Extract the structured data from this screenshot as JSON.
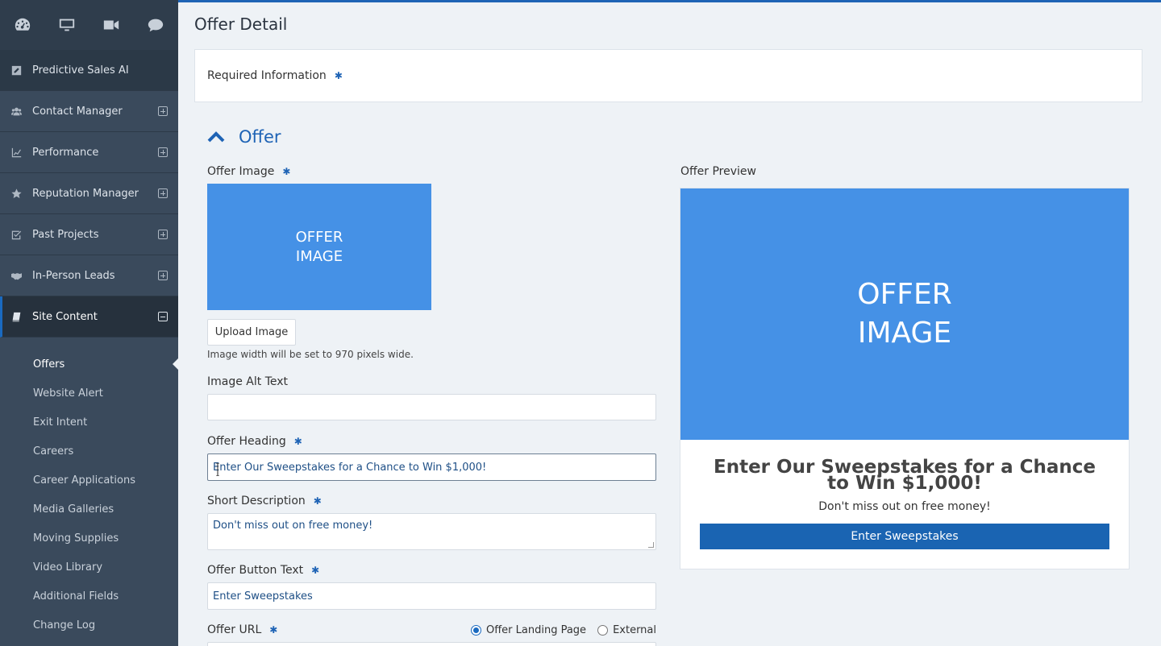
{
  "sidebar": {
    "top_icons": [
      "dashboard-icon",
      "desktop-icon",
      "video-camera-icon",
      "chat-bubble-icon"
    ],
    "items": [
      {
        "label": "Predictive Sales AI",
        "icon": "edit-square-icon"
      },
      {
        "label": "Contact Manager",
        "icon": "users-icon"
      },
      {
        "label": "Performance",
        "icon": "line-chart-icon"
      },
      {
        "label": "Reputation Manager",
        "icon": "star-icon"
      },
      {
        "label": "Past Projects",
        "icon": "check-square-icon"
      },
      {
        "label": "In-Person Leads",
        "icon": "handshake-icon"
      },
      {
        "label": "Site Content",
        "icon": "book-icon"
      }
    ],
    "submenu": [
      "Offers",
      "Website Alert",
      "Exit Intent",
      "Careers",
      "Career Applications",
      "Media Galleries",
      "Moving Supplies",
      "Video Library",
      "Additional Fields",
      "Change Log"
    ]
  },
  "page": {
    "title": "Offer Detail",
    "required_info": "Required Information",
    "required_marker": "✱"
  },
  "offer": {
    "section_title": "Offer",
    "image_label": "Offer Image",
    "image_placeholder_line1": "OFFER",
    "image_placeholder_line2": "IMAGE",
    "upload_button": "Upload Image",
    "image_help": "Image width will be set to 970 pixels wide.",
    "alt_text_label": "Image Alt Text",
    "alt_text_value": "",
    "heading_label": "Offer Heading",
    "heading_value": "Enter Our Sweepstakes for a Chance to Win $1,000!",
    "short_desc_label": "Short Description",
    "short_desc_value": "Don't miss out on free money!",
    "button_text_label": "Offer Button Text",
    "button_text_value": "Enter Sweepstakes",
    "url_label": "Offer URL",
    "url_options": [
      "Offer Landing Page",
      "External"
    ],
    "url_selected": "Offer Landing Page"
  },
  "preview": {
    "label": "Offer Preview",
    "image_line1": "OFFER",
    "image_line2": "IMAGE",
    "heading": "Enter Our Sweepstakes for a Chance to Win $1,000!",
    "description": "Don't miss out on free money!",
    "button": "Enter Sweepstakes"
  },
  "colors": {
    "accent": "#1e63b5",
    "sidebar_bg": "#3a4a5c",
    "placeholder_blue": "#4591e6",
    "page_bg": "#eef2f6"
  }
}
